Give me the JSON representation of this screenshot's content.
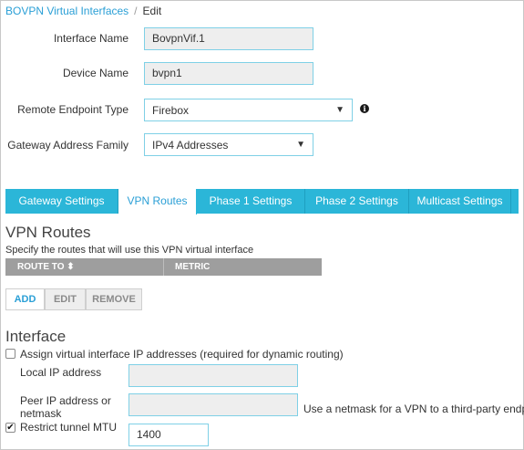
{
  "breadcrumb": {
    "parent": "BOVPN Virtual Interfaces",
    "separator": "/",
    "current": "Edit"
  },
  "form": {
    "interface_name_label": "Interface Name",
    "interface_name_value": "BovpnVif.1",
    "device_name_label": "Device Name",
    "device_name_value": "bvpn1",
    "remote_endpoint_label": "Remote Endpoint Type",
    "remote_endpoint_value": "Firebox",
    "gateway_family_label": "Gateway Address Family",
    "gateway_family_value": "IPv4 Addresses"
  },
  "tabs": [
    {
      "label": "Gateway Settings"
    },
    {
      "label": "VPN Routes"
    },
    {
      "label": "Phase 1 Settings"
    },
    {
      "label": "Phase 2 Settings"
    },
    {
      "label": "Multicast Settings"
    }
  ],
  "active_tab": "VPN Routes",
  "vpn_routes": {
    "title": "VPN Routes",
    "description": "Specify the routes that will use this VPN virtual interface",
    "columns": [
      "ROUTE TO ⬍",
      "METRIC"
    ],
    "buttons": {
      "add": "ADD",
      "edit": "EDIT",
      "remove": "REMOVE"
    }
  },
  "interface_section": {
    "title": "Interface",
    "assign_ip_label": "Assign virtual interface IP addresses (required for dynamic routing)",
    "assign_ip_checked": false,
    "local_ip_label": "Local IP address",
    "local_ip_value": "",
    "peer_ip_label_line1": "Peer IP address or",
    "peer_ip_label_line2": "netmask",
    "peer_ip_value": "",
    "netmask_note": "Use a netmask for a VPN to a third-party endpoint.",
    "restrict_mtu_label": "Restrict tunnel MTU",
    "restrict_mtu_checked": true,
    "mtu_value": "1400"
  },
  "icons": {
    "info": "info-icon",
    "dropdown": "chevron-down-icon",
    "sort": "sort-icon",
    "checkmark": "checkmark-icon"
  },
  "colors": {
    "accent": "#2bb6d8",
    "link": "#2a9fd6",
    "table_header": "#9e9e9e"
  }
}
